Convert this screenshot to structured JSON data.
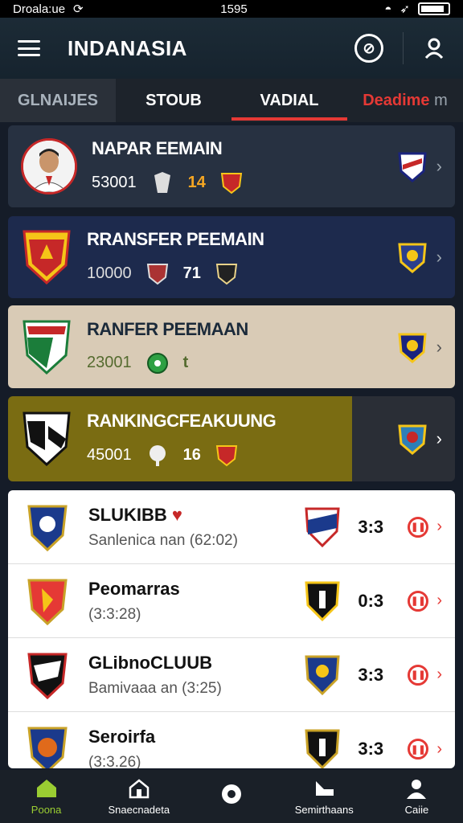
{
  "status": {
    "carrier": "Droala:ue",
    "time": "1595"
  },
  "header": {
    "title": "INDANASIA"
  },
  "tabs": [
    {
      "label": "GLNAIJES"
    },
    {
      "label": "STOUB"
    },
    {
      "label": "VADIAL"
    },
    {
      "label": "Deadime",
      "suffix": "m"
    }
  ],
  "cards": [
    {
      "title": "NAPAR EEMAIN",
      "value": "53001",
      "badge": "14"
    },
    {
      "title": "RRANSFER PEEMAIN",
      "value": "10000",
      "badge": "71"
    },
    {
      "title": "RANFER PEEMAAN",
      "value": "23001",
      "badge": "t"
    },
    {
      "title": "RANKINGCFEAKUUNG",
      "value": "45001",
      "badge": "16"
    }
  ],
  "matches": [
    {
      "name": "SLUKIBB",
      "detail": "Sanlenica nan (62:02)",
      "score": "3:3"
    },
    {
      "name": "Peomarras",
      "detail": "(3:3:28)",
      "score": "0:3"
    },
    {
      "name": "GLibnoCLUUB",
      "detail": "Bamivaaa an (3:25)",
      "score": "3:3"
    },
    {
      "name": "Seroirfa",
      "detail": "(3:3.26)",
      "score": "3:3"
    }
  ],
  "nav": [
    {
      "label": "Poona"
    },
    {
      "label": "Snaecnadeta"
    },
    {
      "label": ""
    },
    {
      "label": "Semirthaans"
    },
    {
      "label": "Caiie"
    }
  ],
  "colors": {
    "accent": "#e53935",
    "active_nav": "#9acd32"
  }
}
